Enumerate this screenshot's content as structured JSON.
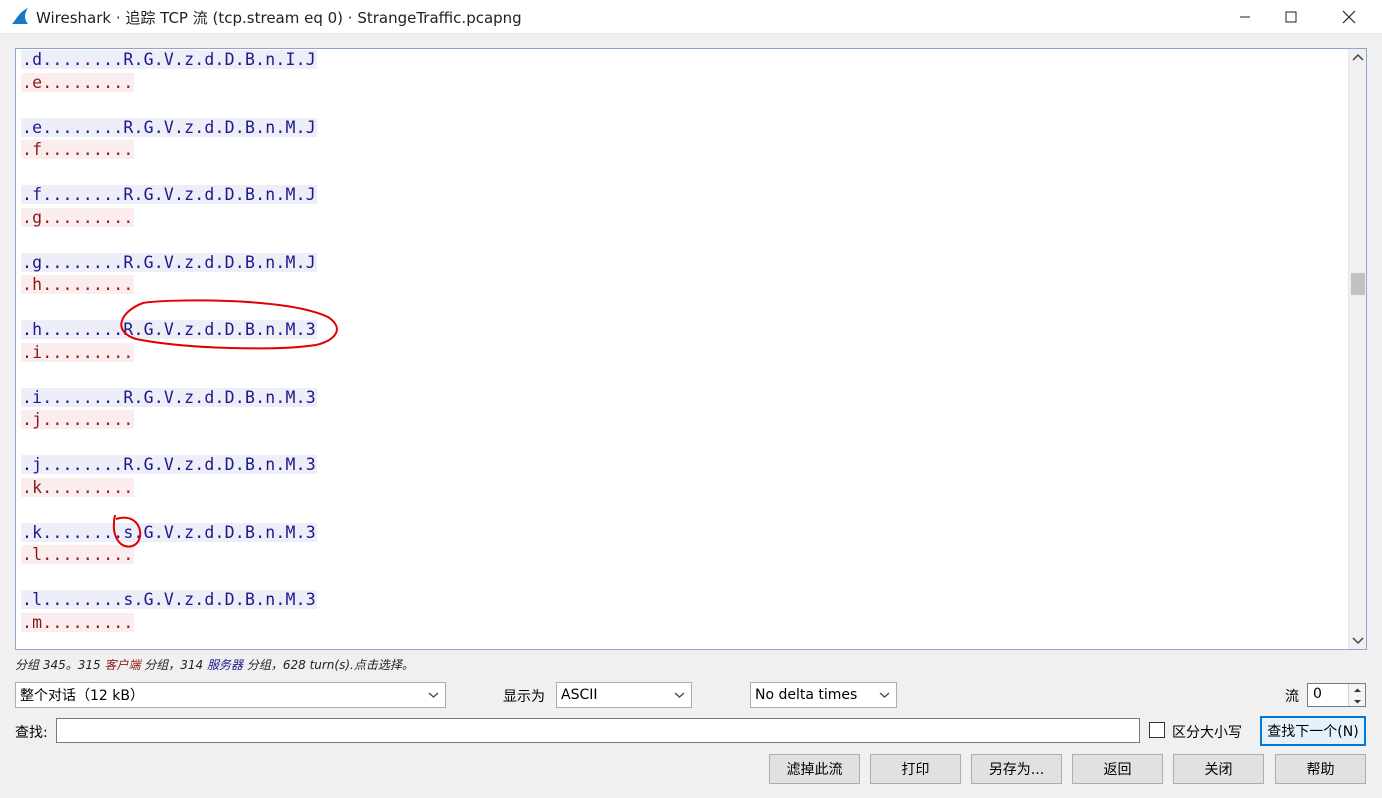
{
  "window": {
    "title": "Wireshark · 追踪 TCP 流 (tcp.stream eq 0) · StrangeTraffic.pcapng"
  },
  "stream": {
    "pairs": [
      {
        "client": ".d........R.G.V.z.d.D.B.n.I.J",
        "server": ".e........."
      },
      {
        "client": ".e........R.G.V.z.d.D.B.n.M.J",
        "server": ".f........."
      },
      {
        "client": ".f........R.G.V.z.d.D.B.n.M.J",
        "server": ".g........."
      },
      {
        "client": ".g........R.G.V.z.d.D.B.n.M.J",
        "server": ".h........."
      },
      {
        "client": ".h........R.G.V.z.d.D.B.n.M.3",
        "server": ".i........."
      },
      {
        "client": ".i........R.G.V.z.d.D.B.n.M.3",
        "server": ".j........."
      },
      {
        "client": ".j........R.G.V.z.d.D.B.n.M.3",
        "server": ".k........."
      },
      {
        "client": ".k........s.G.V.z.d.D.B.n.M.3",
        "server": ".l........."
      },
      {
        "client": ".l........s.G.V.z.d.D.B.n.M.3",
        "server": ".m........."
      }
    ],
    "client_color": "#1a1a8c",
    "server_color": "#8c1a1a",
    "client_bg": "#eeeef8",
    "server_bg": "#fbeded",
    "annotation_color": "#e00000"
  },
  "status": {
    "prefix": "分组 345。315 ",
    "client_label": "客户端",
    "mid": " 分组，314 ",
    "server_label": "服务器",
    "suffix": " 分组，628 turn(s).点击选择。"
  },
  "controls": {
    "conversation": "整个对话（12 kB）",
    "show_as_label": "显示为",
    "show_as_value": "ASCII",
    "delta": "No delta times",
    "stream_label": "流",
    "stream_value": "0",
    "find_label": "查找:",
    "find_value": "",
    "case_label": "区分大小写",
    "find_next": "查找下一个(N)"
  },
  "buttons": {
    "filter_out": "滤掉此流",
    "print": "打印",
    "save_as": "另存为...",
    "back": "返回",
    "close": "关闭",
    "help": "帮助"
  }
}
